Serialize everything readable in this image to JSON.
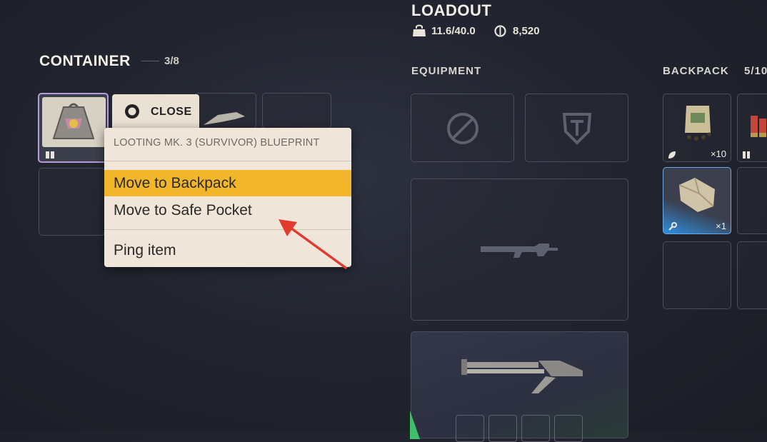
{
  "loadout": {
    "title": "LOADOUT",
    "weight": "11.6/40.0",
    "currency": "8,520"
  },
  "container": {
    "title": "CONTAINER",
    "count": "3/8"
  },
  "equipment": {
    "title": "EQUIPMENT"
  },
  "backpack": {
    "title": "BACKPACK",
    "count": "5/10",
    "items": [
      {
        "quantity": "×10"
      },
      {
        "quantity": "×1"
      }
    ]
  },
  "close_button": {
    "label": "CLOSE"
  },
  "context_menu": {
    "header": "LOOTING MK. 3 (SURVIVOR) BLUEPRINT",
    "items": [
      {
        "label": "Move to Backpack"
      },
      {
        "label": "Move to Safe Pocket"
      },
      {
        "label": "Ping item"
      }
    ]
  },
  "colors": {
    "accent_yellow": "#f1b62a",
    "menu_bg": "#efe6d9",
    "equipped_green": "#3fbf6a",
    "selected_blue": "#2f8fe0"
  }
}
